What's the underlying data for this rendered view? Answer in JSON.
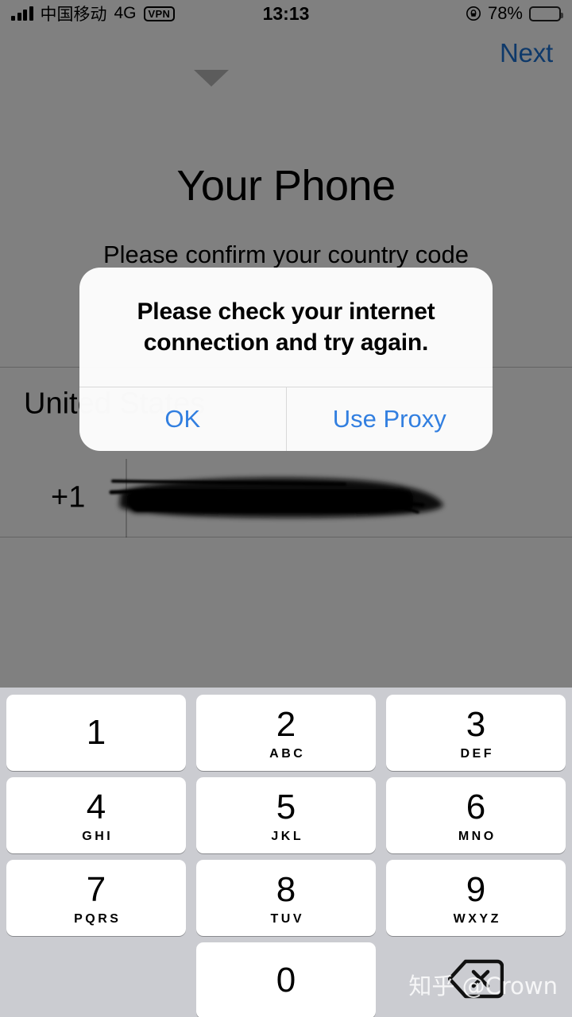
{
  "status_bar": {
    "signal_icon": "signal-bars-icon",
    "carrier": "中国移动",
    "network_type": "4G",
    "vpn_badge": "VPN",
    "time": "13:13",
    "rotation_lock_icon": "rotation-lock-icon",
    "battery_percent": "78%",
    "battery_icon": "battery-icon"
  },
  "nav": {
    "next_label": "Next"
  },
  "page": {
    "title": "Your Phone",
    "subtitle": "Please confirm your country code",
    "country_name": "United States",
    "country_chevron_icon": "chevron-down-icon",
    "country_code": "+1",
    "phone_number_value": "",
    "phone_number_placeholder": "",
    "phone_number_redacted": true
  },
  "alert": {
    "message": "Please check your internet connection and try again.",
    "buttons": [
      {
        "label": "OK",
        "name": "ok-button"
      },
      {
        "label": "Use Proxy",
        "name": "use-proxy-button"
      }
    ]
  },
  "keyboard": {
    "rows": [
      [
        {
          "digit": "1",
          "letters": ""
        },
        {
          "digit": "2",
          "letters": "ABC"
        },
        {
          "digit": "3",
          "letters": "DEF"
        }
      ],
      [
        {
          "digit": "4",
          "letters": "GHI"
        },
        {
          "digit": "5",
          "letters": "JKL"
        },
        {
          "digit": "6",
          "letters": "MNO"
        }
      ],
      [
        {
          "digit": "7",
          "letters": "PQRS"
        },
        {
          "digit": "8",
          "letters": "TUV"
        },
        {
          "digit": "9",
          "letters": "WXYZ"
        }
      ],
      [
        {
          "digit": "0",
          "letters": ""
        }
      ]
    ],
    "delete_icon": "delete-backspace-icon"
  },
  "watermark": {
    "text": "知乎 @Crown"
  },
  "colors": {
    "accent_blue": "#327fe0",
    "nav_blue": "#1c72d4",
    "keyboard_bg": "#cbccd1",
    "key_bg": "#ffffff",
    "dim_overlay": "rgba(0,0,0,0.5)"
  }
}
